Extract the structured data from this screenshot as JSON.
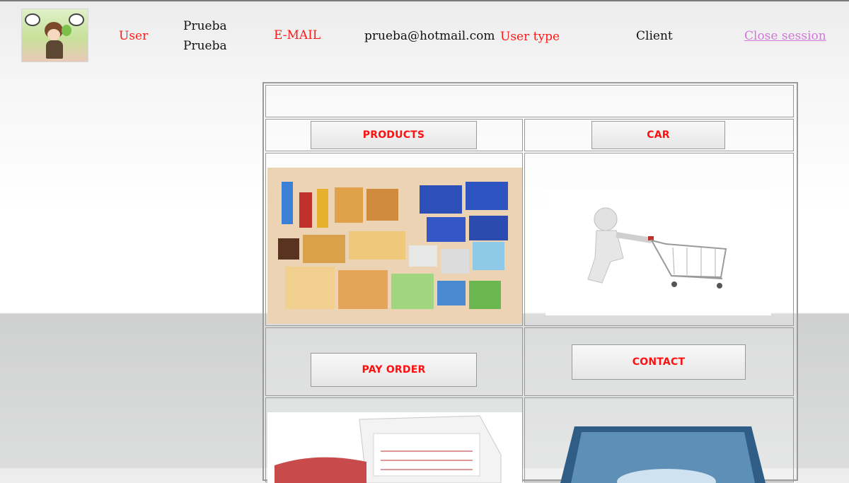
{
  "header": {
    "user_label": "User",
    "user_value_line1": "Prueba",
    "user_value_line2": "Prueba",
    "email_label": "E-MAIL",
    "email_value": "prueba@hotmail.com",
    "user_type_label": "User type",
    "user_type_value": "Client",
    "close_session": "Close session"
  },
  "menu": {
    "products": "PRODUCTS",
    "car": "CAR",
    "pay_order": "PAY ORDER",
    "contact": "CONTACT"
  },
  "colors": {
    "label_red": "#ff1a1a",
    "link_pink": "#d177d8"
  }
}
